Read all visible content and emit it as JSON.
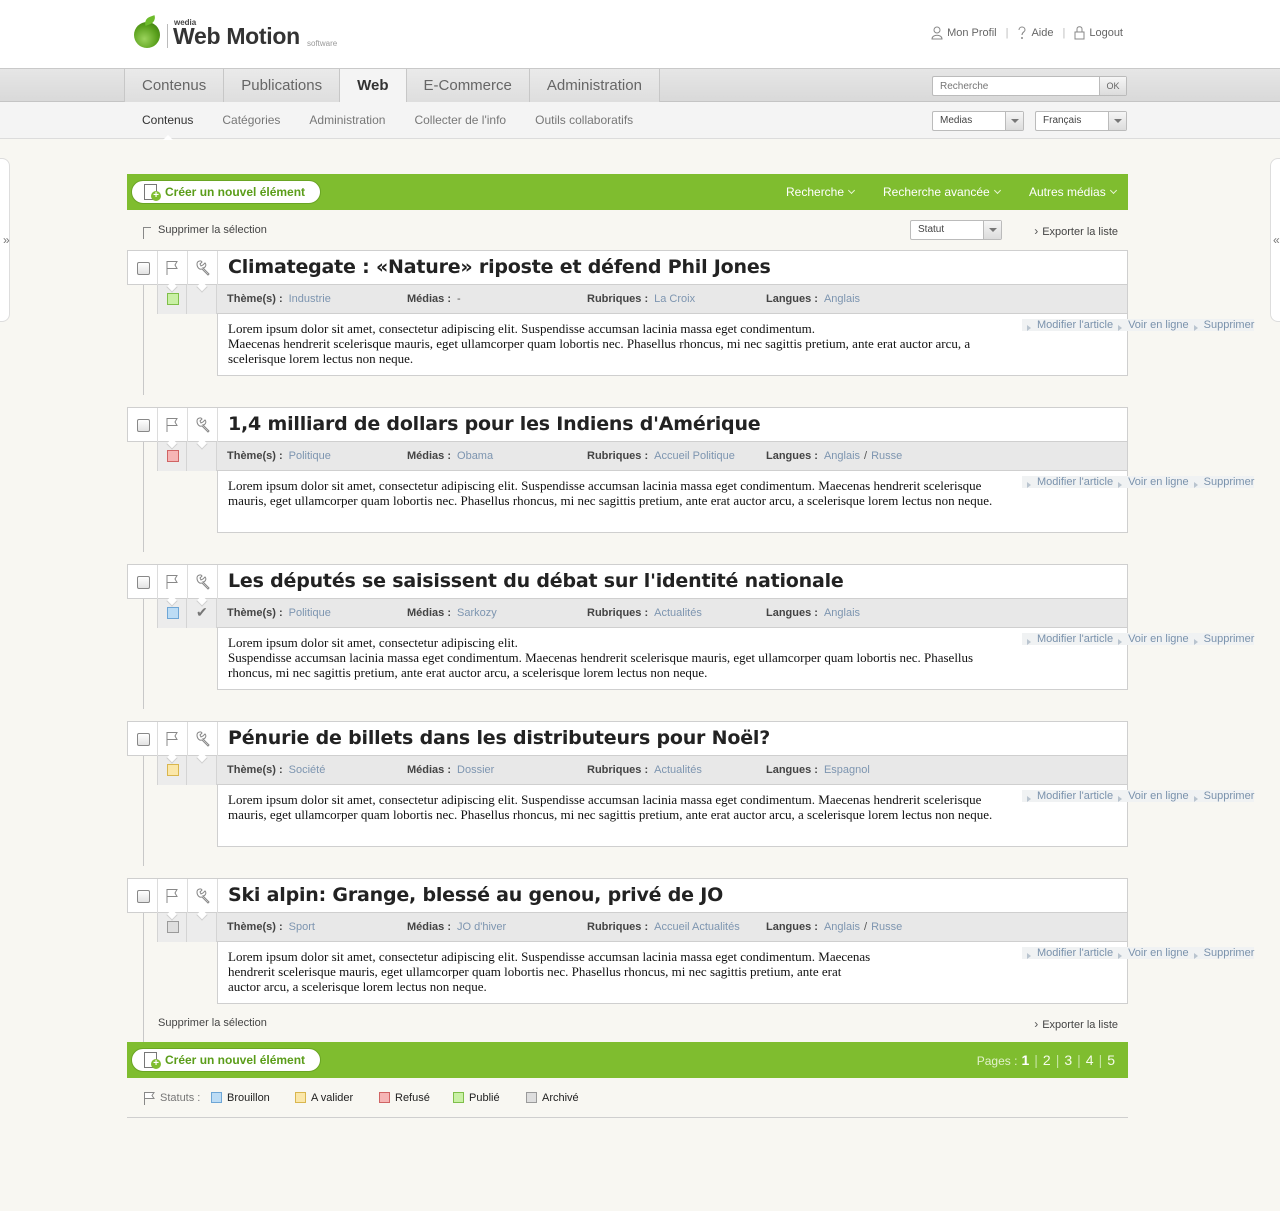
{
  "logo": {
    "brand": "wedia",
    "title": "Web Motion",
    "sub": "software"
  },
  "topnav": {
    "profile": "Mon Profil",
    "help": "Aide",
    "logout": "Logout"
  },
  "tabs": [
    {
      "label": "Contenus",
      "active": false
    },
    {
      "label": "Publications",
      "active": false
    },
    {
      "label": "Web",
      "active": true
    },
    {
      "label": "E-Commerce",
      "active": false
    },
    {
      "label": "Administration",
      "active": false
    }
  ],
  "search": {
    "placeholder": "Recherche",
    "button": "OK"
  },
  "subtabs": [
    {
      "label": "Contenus",
      "active": true
    },
    {
      "label": "Catégories",
      "active": false
    },
    {
      "label": "Administration",
      "active": false
    },
    {
      "label": "Collecter de l'info",
      "active": false
    },
    {
      "label": "Outils collaboratifs",
      "active": false
    }
  ],
  "selects": {
    "media": "Medias",
    "language": "Français",
    "statut": "Statut"
  },
  "toolbar": {
    "create": "Créer un nouvel élément",
    "recherche": "Recherche",
    "recherche_avancee": "Recherche avancée",
    "autres_medias": "Autres médias",
    "delete_selection": "Supprimer la sélection",
    "export": "Exporter la liste"
  },
  "labels": {
    "themes": "Thème(s) :",
    "medias": "Médias :",
    "rubriques": "Rubriques :",
    "langues": "Langues :"
  },
  "actions": {
    "edit": "Modifier l'article",
    "view": "Voir en ligne",
    "delete": "Supprimer"
  },
  "status_colors": {
    "Brouillon": {
      "fill": "#bcdcf5",
      "border": "#6ea6d6"
    },
    "A valider": {
      "fill": "#fbe7a9",
      "border": "#d9b64e"
    },
    "Refusé": {
      "fill": "#f6b5b5",
      "border": "#d06464"
    },
    "Publié": {
      "fill": "#c9f0a5",
      "border": "#7fbf4a"
    },
    "Archivé": {
      "fill": "#dedede",
      "border": "#9a9a9a"
    }
  },
  "articles": [
    {
      "title": "Climategate : «Nature» riposte et défend Phil Jones",
      "status": "Publié",
      "checked": false,
      "themes": [
        "Industrie"
      ],
      "medias": [
        "-"
      ],
      "rubriques": [
        "La Croix"
      ],
      "langues": [
        "Anglais"
      ],
      "text": [
        "Lorem ipsum dolor sit amet, consectetur adipiscing elit. Suspendisse accumsan lacinia massa eget condimentum.",
        "Maecenas hendrerit scelerisque mauris, eget ullamcorper quam lobortis nec. Phasellus rhoncus, mi nec sagittis pretium, ante erat auctor arcu, a scelerisque lorem lectus non neque."
      ]
    },
    {
      "title": "1,4 milliard de dollars pour les Indiens d'Amérique",
      "status": "Refusé",
      "checked": false,
      "themes": [
        "Politique"
      ],
      "medias": [
        "Obama"
      ],
      "rubriques": [
        "Accueil Politique"
      ],
      "langues": [
        "Anglais",
        "Russe"
      ],
      "text": [
        "Lorem ipsum dolor sit amet, consectetur adipiscing elit. Suspendisse accumsan lacinia massa eget condimentum. Maecenas hendrerit scelerisque mauris, eget ullamcorper quam lobortis nec. Phasellus rhoncus, mi nec sagittis pretium, ante erat auctor arcu, a scelerisque lorem lectus non neque."
      ]
    },
    {
      "title": "Les députés se saisissent du débat sur l'identité nationale",
      "status": "Brouillon",
      "checked": true,
      "themes": [
        "Politique"
      ],
      "medias": [
        "Sarkozy"
      ],
      "rubriques": [
        "Actualités"
      ],
      "langues": [
        "Anglais"
      ],
      "text": [
        "Lorem ipsum dolor sit amet, consectetur adipiscing elit.",
        "Suspendisse accumsan lacinia massa eget condimentum. Maecenas hendrerit scelerisque mauris, eget ullamcorper quam lobortis nec. Phasellus rhoncus, mi nec sagittis pretium, ante erat auctor arcu, a scelerisque lorem lectus non neque."
      ]
    },
    {
      "title": "Pénurie de billets dans les distributeurs pour Noël?",
      "status": "A valider",
      "checked": false,
      "themes": [
        "Société"
      ],
      "medias": [
        "Dossier"
      ],
      "rubriques": [
        "Actualités"
      ],
      "langues": [
        "Espagnol"
      ],
      "text": [
        "Lorem ipsum dolor sit amet, consectetur adipiscing elit. Suspendisse accumsan lacinia massa eget condimentum. Maecenas hendrerit scelerisque mauris, eget ullamcorper quam lobortis nec. Phasellus rhoncus, mi nec sagittis pretium, ante erat auctor arcu, a scelerisque lorem lectus non neque."
      ]
    },
    {
      "title": "Ski alpin: Grange, blessé au genou, privé de JO",
      "status": "Archivé",
      "checked": false,
      "themes": [
        "Sport"
      ],
      "medias": [
        "JO d'hiver"
      ],
      "rubriques": [
        "Accueil Actualités"
      ],
      "langues": [
        "Anglais",
        "Russe"
      ],
      "text": [
        "Lorem ipsum dolor sit amet, consectetur adipiscing elit. Suspendisse accumsan lacinia massa eget condimentum. Maecenas",
        "hendrerit scelerisque mauris, eget ullamcorper quam lobortis nec. Phasellus rhoncus, mi nec sagittis pretium, ante erat",
        "auctor arcu, a scelerisque lorem lectus non neque."
      ]
    }
  ],
  "pagination": {
    "label": "Pages :",
    "pages": [
      "1",
      "2",
      "3",
      "4",
      "5"
    ],
    "current": "1"
  },
  "legend": {
    "label": "Statuts :",
    "items": [
      "Brouillon",
      "A valider",
      "Refusé",
      "Publié",
      "Archivé"
    ]
  }
}
